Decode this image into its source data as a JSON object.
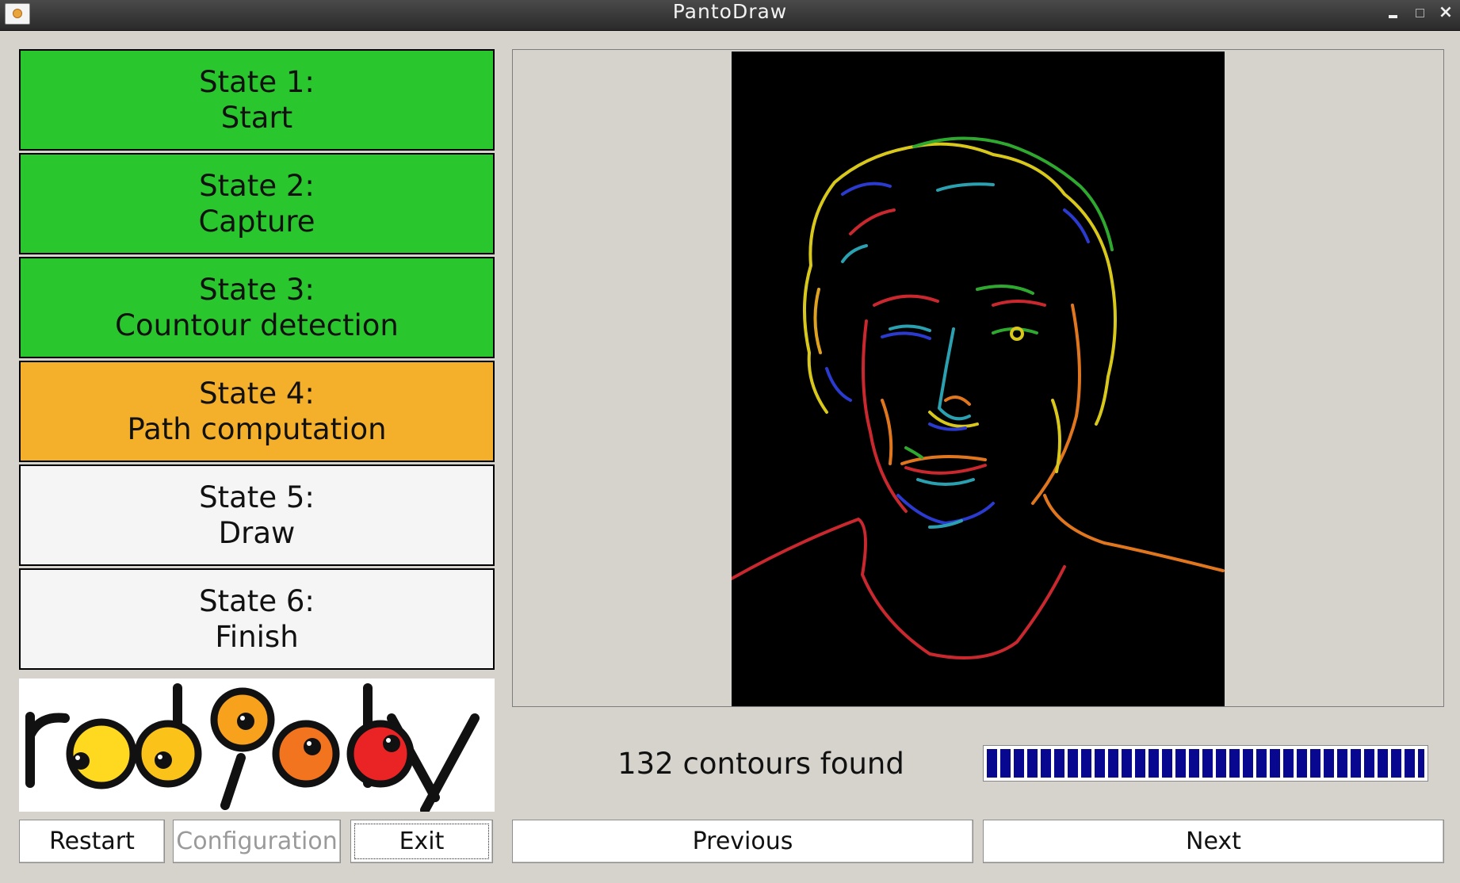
{
  "window": {
    "title": "PantoDraw"
  },
  "states": [
    {
      "number": "State 1:",
      "name": "Start",
      "color": "#29c72d"
    },
    {
      "number": "State 2:",
      "name": "Capture",
      "color": "#29c72d"
    },
    {
      "number": "State 3:",
      "name": "Countour detection",
      "color": "#29c72d"
    },
    {
      "number": "State 4:",
      "name": "Path computation",
      "color": "#f5b02b"
    },
    {
      "number": "State 5:",
      "name": "Draw",
      "color": "#f5f5f5"
    },
    {
      "number": "State 6:",
      "name": "Finish",
      "color": "#f5f5f5"
    }
  ],
  "logo": {
    "text": "robopoly"
  },
  "buttons": {
    "restart": "Restart",
    "configuration": "Configuration",
    "exit": "Exit",
    "previous": "Previous",
    "next": "Next"
  },
  "status": {
    "text": "132 contours found",
    "progress_fraction": 1.0
  },
  "colors": {
    "done": "#29c72d",
    "active": "#f5b02b",
    "pending": "#f5f5f5",
    "progress": "#07078f"
  }
}
